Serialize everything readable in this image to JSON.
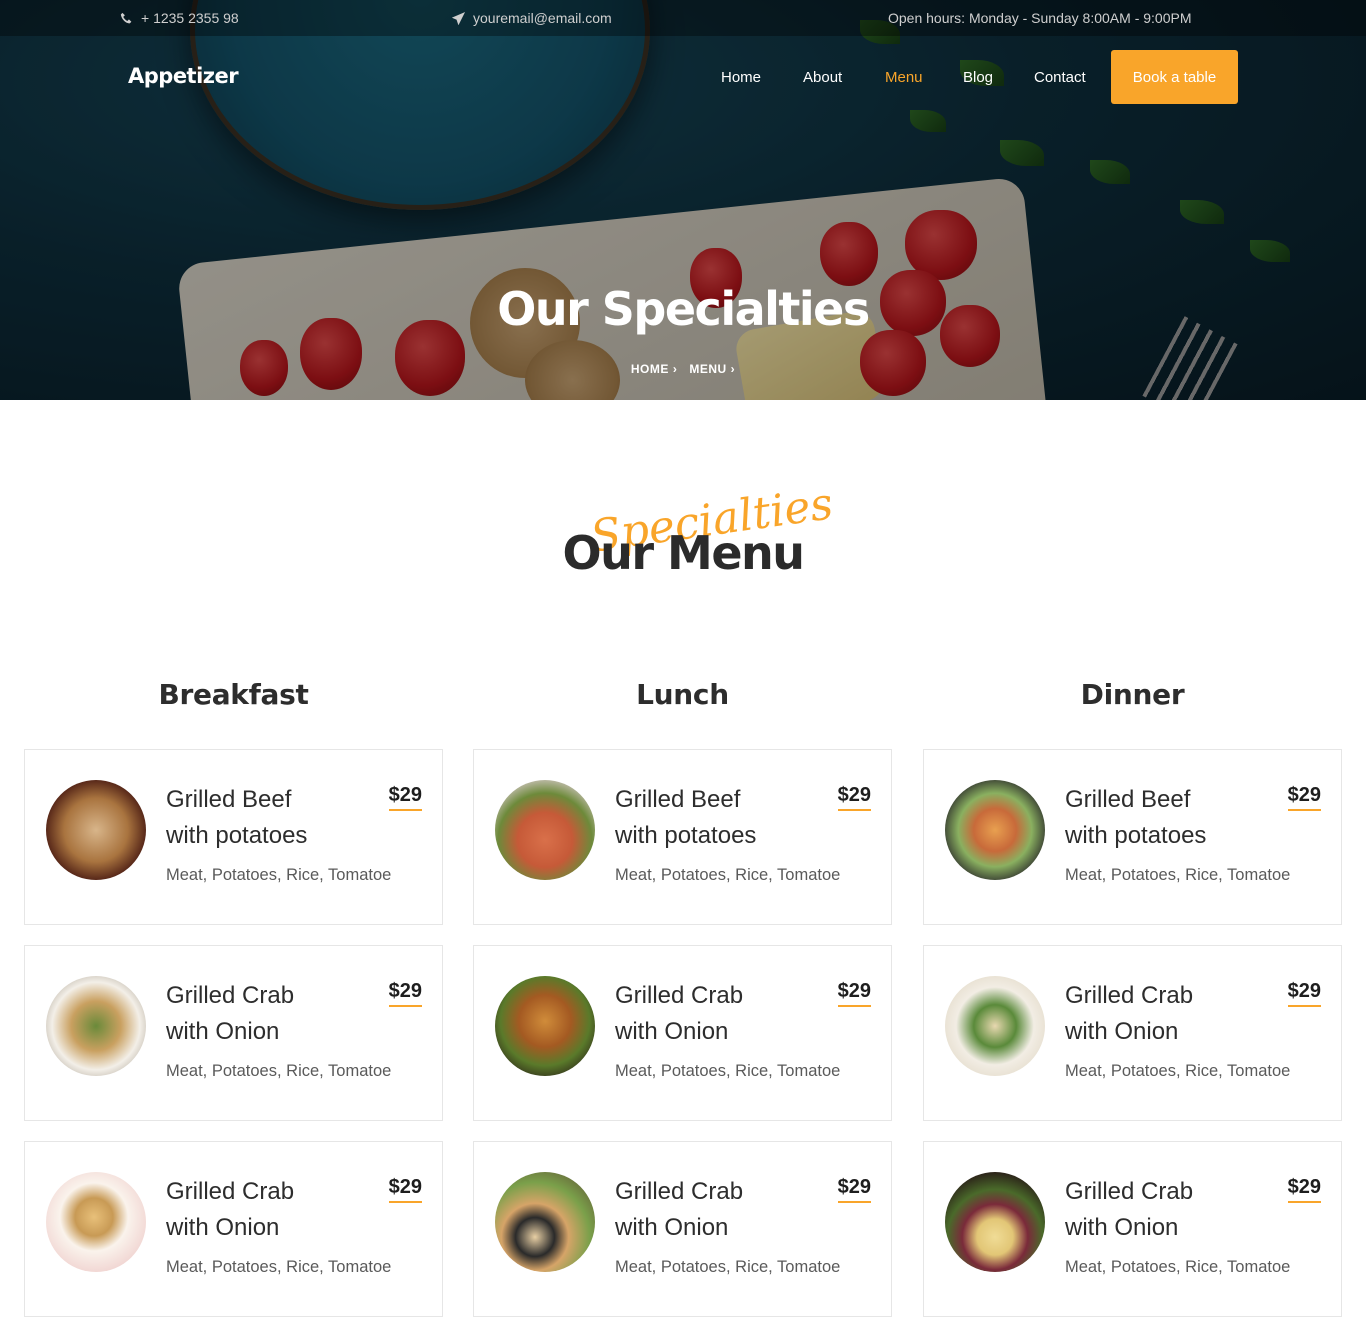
{
  "topbar": {
    "phone": "+ 1235 2355 98",
    "email": "youremail@email.com",
    "hours": "Open hours: Monday - Sunday 8:00AM - 9:00PM"
  },
  "brand": {
    "logo": "Appetizer"
  },
  "nav": {
    "items": [
      "Home",
      "About",
      "Menu",
      "Blog",
      "Contact"
    ],
    "active": "Menu",
    "cta": "Book a table"
  },
  "hero": {
    "title": "Our Specialties",
    "breadcrumb": [
      "HOME",
      "MENU"
    ]
  },
  "section": {
    "script_text": "Specialties",
    "title": "Our Menu"
  },
  "colors": {
    "accent": "#f9a52a",
    "heading": "#2b2b2b"
  },
  "menu": {
    "columns": [
      {
        "title": "Breakfast",
        "items": [
          {
            "name_line1": "Grilled Beef",
            "name_line2": "with potatoes",
            "price": "$29",
            "desc": "Meat, Potatoes, Rice, Tomatoe"
          },
          {
            "name_line1": "Grilled Crab",
            "name_line2": "with Onion",
            "price": "$29",
            "desc": "Meat, Potatoes, Rice, Tomatoe"
          },
          {
            "name_line1": "Grilled Crab",
            "name_line2": "with Onion",
            "price": "$29",
            "desc": "Meat, Potatoes, Rice, Tomatoe"
          }
        ]
      },
      {
        "title": "Lunch",
        "items": [
          {
            "name_line1": "Grilled Beef",
            "name_line2": "with potatoes",
            "price": "$29",
            "desc": "Meat, Potatoes, Rice, Tomatoe"
          },
          {
            "name_line1": "Grilled Crab",
            "name_line2": "with Onion",
            "price": "$29",
            "desc": "Meat, Potatoes, Rice, Tomatoe"
          },
          {
            "name_line1": "Grilled Crab",
            "name_line2": "with Onion",
            "price": "$29",
            "desc": "Meat, Potatoes, Rice, Tomatoe"
          }
        ]
      },
      {
        "title": "Dinner",
        "items": [
          {
            "name_line1": "Grilled Beef",
            "name_line2": "with potatoes",
            "price": "$29",
            "desc": "Meat, Potatoes, Rice, Tomatoe"
          },
          {
            "name_line1": "Grilled Crab",
            "name_line2": "with Onion",
            "price": "$29",
            "desc": "Meat, Potatoes, Rice, Tomatoe"
          },
          {
            "name_line1": "Grilled Crab",
            "name_line2": "with Onion",
            "price": "$29",
            "desc": "Meat, Potatoes, Rice, Tomatoe"
          }
        ]
      }
    ]
  }
}
